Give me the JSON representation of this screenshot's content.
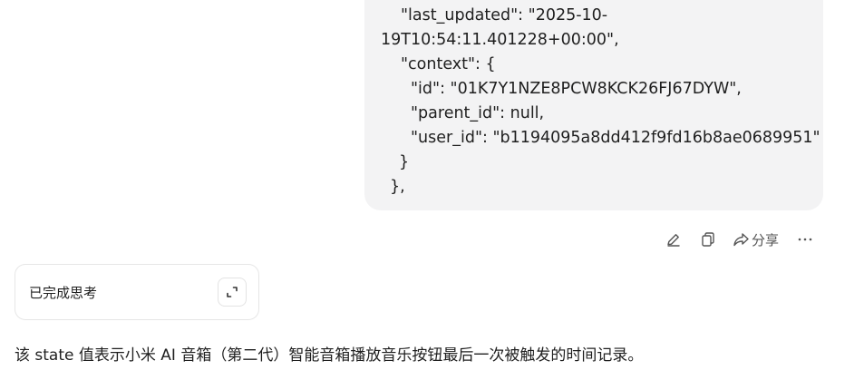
{
  "code_block": {
    "lines": [
      "\"last_updated\": \"2025-10-",
      "19T10:54:11.401228+00:00\",",
      "\"context\": {",
      "\"id\": \"01K7Y1NZE8PCW8KCK26FJ67DYW\",",
      "\"parent_id\": null,",
      "\"user_id\": \"b1194095a8dd412f9fd16b8ae0689951\"",
      "}",
      "},"
    ]
  },
  "actions": {
    "edit_icon": "pencil-icon",
    "copy_icon": "copy-icon",
    "share_label": "分享",
    "share_icon": "share-icon",
    "more_icon": "more-icon"
  },
  "thinking": {
    "label": "已完成思考",
    "expand_icon": "expand-icon"
  },
  "answer": {
    "text": "该 state 值表示小米 AI 音箱（第二代）智能音箱播放音乐按钮最后一次被触发的时间记录。"
  }
}
